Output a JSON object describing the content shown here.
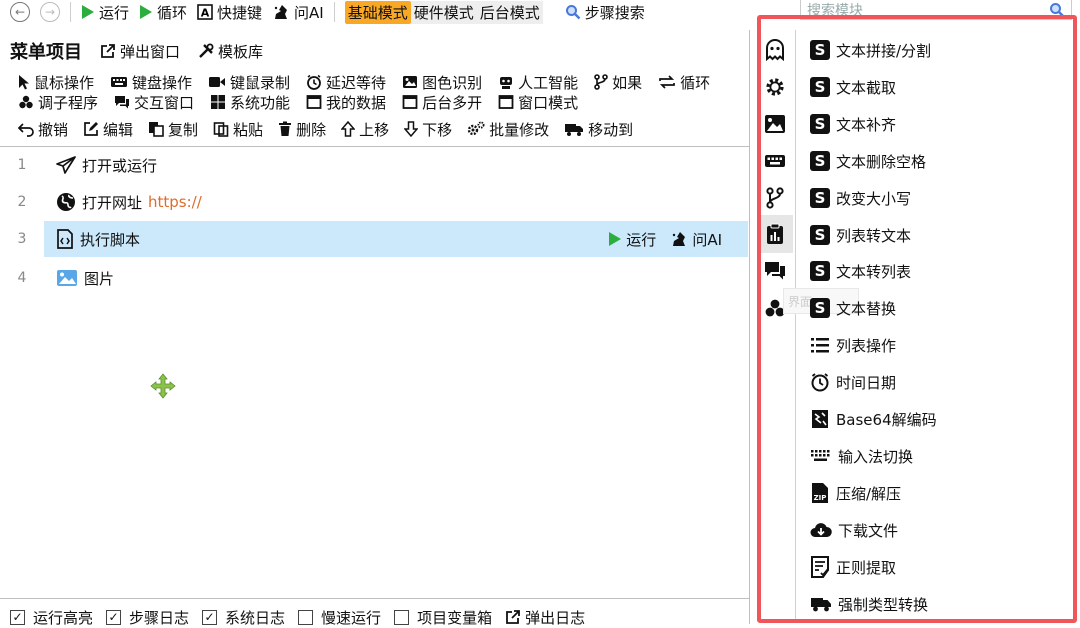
{
  "toolbar": {
    "run": "运行",
    "loop": "循环",
    "hotkey": "快捷键",
    "ask_ai": "问AI",
    "mode_basic": "基础模式",
    "mode_hw": "硬件模式",
    "mode_bg": "后台模式",
    "step_search": "步骤搜索"
  },
  "menu": {
    "title": "菜单项目",
    "popup": "弹出窗口",
    "templates": "模板库"
  },
  "categories_row1": [
    "鼠标操作",
    "键盘操作",
    "键鼠录制",
    "延迟等待",
    "图色识别",
    "人工智能",
    "如果",
    "循环"
  ],
  "categories_row2": [
    "调子程序",
    "交互窗口",
    "系统功能",
    "我的数据",
    "后台多开",
    "窗口模式"
  ],
  "edit": {
    "undo": "撤销",
    "edit": "编辑",
    "copy": "复制",
    "paste": "粘贴",
    "delete": "删除",
    "up": "上移",
    "down": "下移",
    "batch": "批量修改",
    "move_to": "移动到"
  },
  "steps": [
    {
      "num": "1",
      "label": "打开或运行",
      "extra": ""
    },
    {
      "num": "2",
      "label": "打开网址",
      "extra": "https://"
    },
    {
      "num": "3",
      "label": "执行脚本",
      "extra": "",
      "run": "运行",
      "ai": "问AI"
    },
    {
      "num": "4",
      "label": "图片",
      "extra": ""
    }
  ],
  "bottom": {
    "run_highlight": "运行高亮",
    "step_log": "步骤日志",
    "system_log": "系统日志",
    "slow_run": "慢速运行",
    "project_vars": "项目变量箱",
    "popup_log": "弹出日志"
  },
  "right": {
    "search_placeholder": "搜索模块",
    "tooltip": "界面",
    "modules": [
      "文本拼接/分割",
      "文本截取",
      "文本补齐",
      "文本删除空格",
      "改变大小写",
      "列表转文本",
      "文本转列表",
      "文本替换",
      "列表操作",
      "时间日期",
      "Base64解编码",
      "输入法切换",
      "压缩/解压",
      "下载文件",
      "正则提取",
      "强制类型转换"
    ],
    "s_badge": "S"
  },
  "colors": {
    "accent_green": "#2cae3f",
    "mode_basic_bg": "#f9a825",
    "selected_row_bg": "#cce8fb",
    "highlight_border": "#f0555a",
    "url_color": "#e06b2a"
  }
}
